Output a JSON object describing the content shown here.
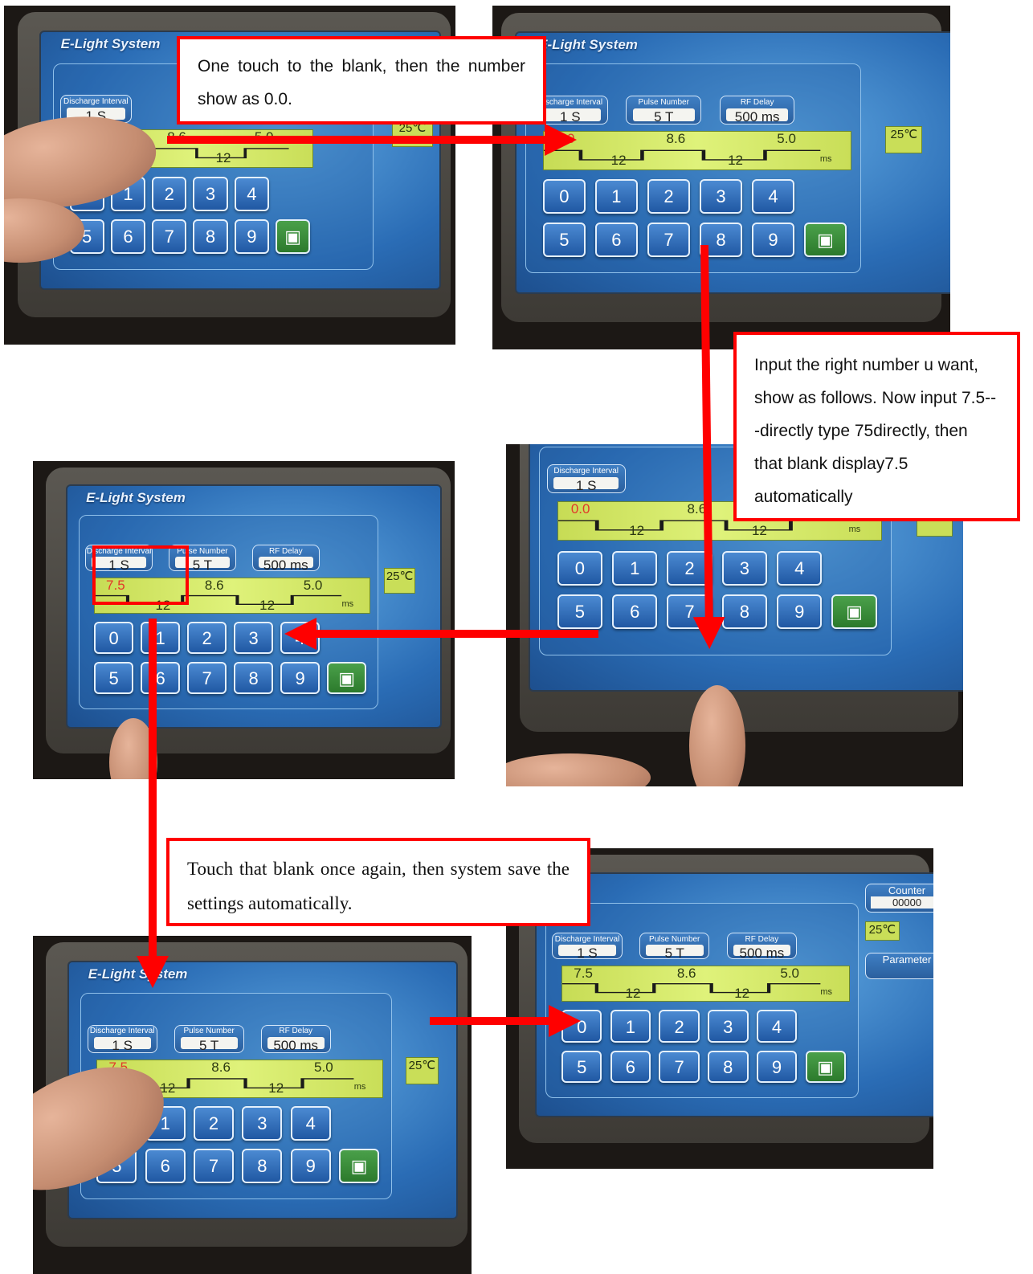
{
  "screen": {
    "title": "E-Light System",
    "discharge_label": "Discharge Interval",
    "discharge_value": "1 S",
    "pulse_label": "Pulse Number",
    "pulse_value": "5 T",
    "rf_label": "RF Delay",
    "rf_value": "500 ms",
    "counter_label": "Counter",
    "counter_value": "00000",
    "temperature": "25℃",
    "param_label": "Parameter",
    "wave_values": {
      "touched": "0.0",
      "entered": "7.5",
      "second": "8.6",
      "third": "5.0",
      "gap1": "12",
      "gap2": "12",
      "unit": "ms"
    },
    "keys": [
      "0",
      "1",
      "2",
      "3",
      "4",
      "5",
      "6",
      "7",
      "8",
      "9"
    ],
    "save_icon": "floppy-disk-icon"
  },
  "callouts": {
    "step1": "One touch to the blank, then the number show as 0.0.",
    "step2": "Input the right number u want, show as follows. Now input 7.5---directly type 75directly, then that blank display7.5 automatically",
    "step3": "Touch that blank once again, then system save the settings automatically."
  },
  "colors": {
    "arrow": "#ff0000",
    "screen": "#2a6cb5",
    "wave": "#dff27a",
    "highlight_value": "#e2382a"
  }
}
